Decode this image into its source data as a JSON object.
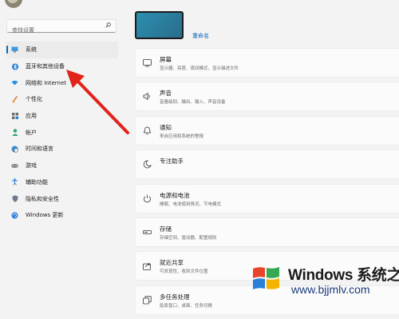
{
  "search": {
    "placeholder": "查找设置"
  },
  "sidebar": {
    "items": [
      {
        "label": "系统",
        "icon": "monitor-icon",
        "active": true
      },
      {
        "label": "蓝牙和其他设备",
        "icon": "bluetooth-icon"
      },
      {
        "label": "网络和 Internet",
        "icon": "wifi-icon"
      },
      {
        "label": "个性化",
        "icon": "paintbrush-icon"
      },
      {
        "label": "应用",
        "icon": "apps-icon"
      },
      {
        "label": "帐户",
        "icon": "person-icon"
      },
      {
        "label": "时间和语言",
        "icon": "globe-clock-icon"
      },
      {
        "label": "游戏",
        "icon": "gamepad-icon"
      },
      {
        "label": "辅助功能",
        "icon": "accessibility-icon"
      },
      {
        "label": "隐私和安全性",
        "icon": "shield-icon"
      },
      {
        "label": "Windows 更新",
        "icon": "update-icon"
      }
    ]
  },
  "device": {
    "rename_label": "重命名"
  },
  "cards": [
    {
      "title": "屏幕",
      "subtitle": "显示器、亮度、夜间模式、显示描述文件",
      "icon": "display-icon"
    },
    {
      "title": "声音",
      "subtitle": "音量级别、输出、输入、声音设备",
      "icon": "speaker-icon"
    },
    {
      "title": "通知",
      "subtitle": "来自应用和系统的警报",
      "icon": "bell-icon"
    },
    {
      "title": "专注助手",
      "subtitle": "",
      "icon": "moon-icon"
    },
    {
      "title": "电源和电池",
      "subtitle": "睡眠、电池使用情况、节电模式",
      "icon": "power-icon"
    },
    {
      "title": "存储",
      "subtitle": "存储空间、驱动器、配置规则",
      "icon": "storage-icon"
    },
    {
      "title": "就近共享",
      "subtitle": "可发现性、收到文件位置",
      "icon": "share-icon"
    },
    {
      "title": "多任务处理",
      "subtitle": "贴靠窗口、桌面、任务切换",
      "icon": "multitask-icon"
    }
  ],
  "watermark": {
    "title": "Windows 系统之家",
    "url": "www.bjjmlv.com"
  },
  "colors": {
    "accent": "#0067c0",
    "arrow": "#e2231a",
    "background": "#f3f3f3"
  }
}
